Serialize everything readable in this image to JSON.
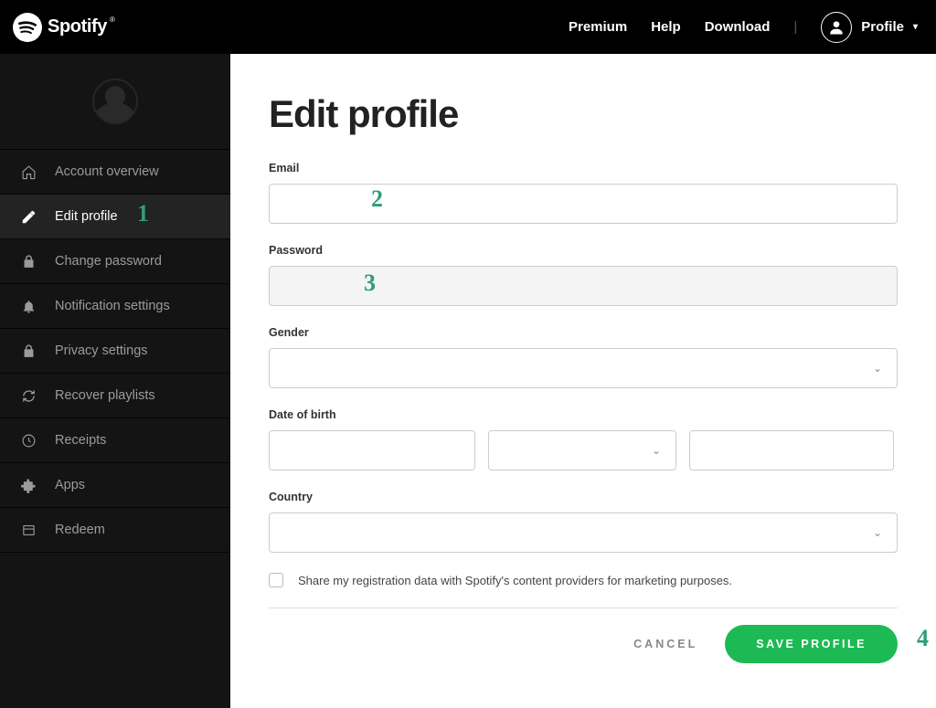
{
  "brand": {
    "name": "Spotify"
  },
  "topnav": {
    "premium": "Premium",
    "help": "Help",
    "download": "Download",
    "profile": "Profile"
  },
  "sidebar": {
    "items": [
      {
        "key": "overview",
        "label": "Account overview"
      },
      {
        "key": "edit",
        "label": "Edit profile"
      },
      {
        "key": "password",
        "label": "Change password"
      },
      {
        "key": "notif",
        "label": "Notification settings"
      },
      {
        "key": "privacy",
        "label": "Privacy settings"
      },
      {
        "key": "recover",
        "label": "Recover playlists"
      },
      {
        "key": "receipts",
        "label": "Receipts"
      },
      {
        "key": "apps",
        "label": "Apps"
      },
      {
        "key": "redeem",
        "label": "Redeem"
      }
    ],
    "active_index": 1
  },
  "page": {
    "title": "Edit profile",
    "labels": {
      "email": "Email",
      "password": "Password",
      "gender": "Gender",
      "dob": "Date of birth",
      "country": "Country"
    },
    "values": {
      "email": "",
      "password": "",
      "gender": "",
      "dob_day": "",
      "dob_month": "",
      "dob_year": "",
      "country": ""
    },
    "checkbox_text": "Share my registration data with Spotify's content providers for marketing purposes.",
    "buttons": {
      "cancel": "CANCEL",
      "save": "SAVE PROFILE"
    }
  },
  "annotations": {
    "a1": "1",
    "a2": "2",
    "a3": "3",
    "a4": "4"
  }
}
